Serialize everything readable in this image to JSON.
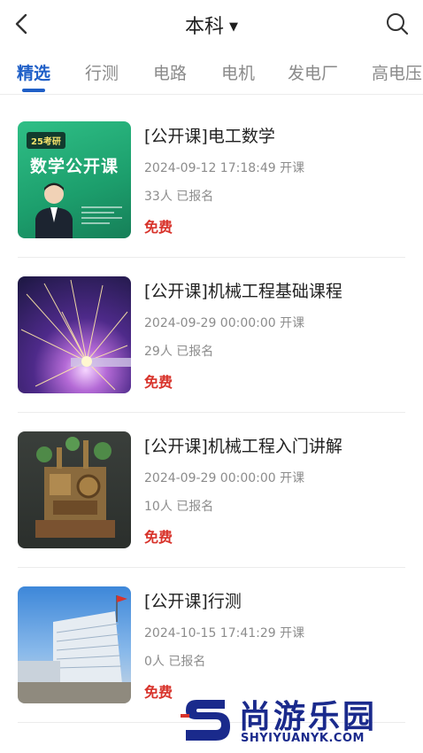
{
  "header": {
    "title": "本科",
    "caret": "▼"
  },
  "tabs": [
    {
      "label": "精选",
      "active": true
    },
    {
      "label": "行测",
      "active": false
    },
    {
      "label": "电路",
      "active": false
    },
    {
      "label": "电机",
      "active": false
    },
    {
      "label": "发电厂",
      "active": false
    },
    {
      "label": "高电压",
      "active": false
    }
  ],
  "courses": [
    {
      "title": "[公开课]电工数学",
      "time": "2024-09-12 17:18:49 开课",
      "count": "33人 已报名",
      "price": "免费",
      "thumb_badge": "25考研",
      "thumb_title": "数学公开课"
    },
    {
      "title": "[公开课]机械工程基础课程",
      "time": "2024-09-29 00:00:00 开课",
      "count": "29人 已报名",
      "price": "免费"
    },
    {
      "title": "[公开课]机械工程入门讲解",
      "time": "2024-09-29 00:00:00 开课",
      "count": "10人 已报名",
      "price": "免费"
    },
    {
      "title": "[公开课]行测",
      "time": "2024-10-15 17:41:29 开课",
      "count": "0人 已报名",
      "price": "免费"
    }
  ],
  "watermark": {
    "name": "尚游乐园",
    "url": "SHYIYUANYK.COM"
  },
  "colors": {
    "accent": "#1f5fc7",
    "price": "#d8332b",
    "watermark": "#1a2a8c"
  }
}
